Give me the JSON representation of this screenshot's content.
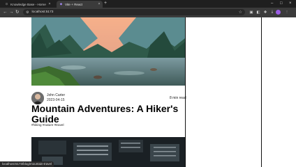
{
  "browser": {
    "tabs": [
      {
        "label": "Knowledge Base - Home",
        "active": false
      },
      {
        "label": "Vite + React",
        "active": true
      }
    ],
    "new_tab": "+",
    "address": "localhost:5173",
    "status_url": "localhost:5173/blog/mountain-travel"
  },
  "post": {
    "author": "John Carter",
    "date": "2023-04-15",
    "read_time": "8 min read",
    "title": "Mountain Adventures: A Hiker's Guide",
    "tags": "#hiking #nature #travel"
  },
  "colors": {
    "tab_bar": "#1f1f1f",
    "toolbar": "#3b3b3b",
    "profile": "#9b5de5"
  }
}
